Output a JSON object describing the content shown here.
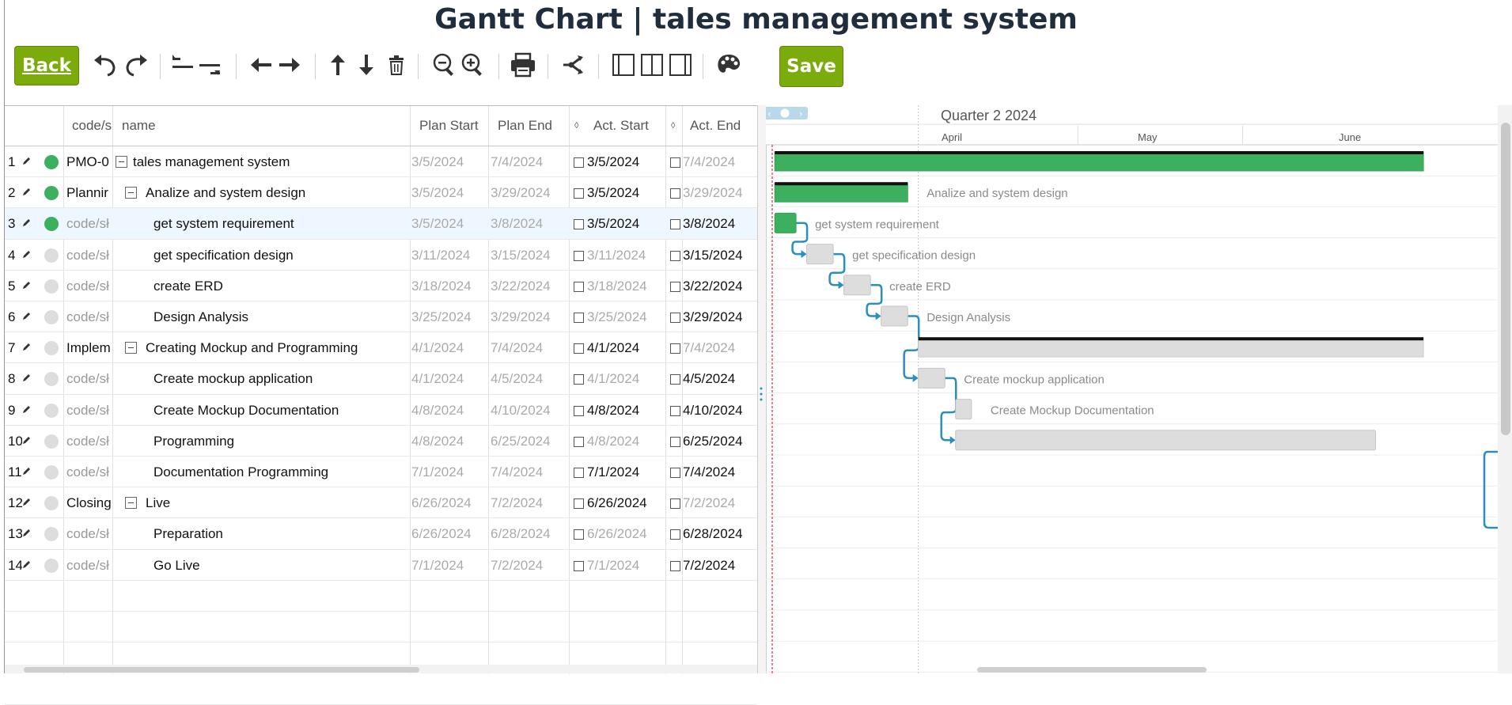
{
  "page_title": "Gantt Chart | tales management system",
  "toolbar": {
    "back_label": "Back",
    "save_label": "Save"
  },
  "grid": {
    "headers": {
      "code": "code/s",
      "name": "name",
      "plan_start": "Plan Start",
      "plan_end": "Plan End",
      "act_start": "Act. Start",
      "act_end": "Act. End"
    },
    "rows": [
      {
        "num": "1",
        "code": "PMO-0",
        "name": "tales management system",
        "indent": 0,
        "collapse": true,
        "status": "on",
        "plan_start": "3/5/2024",
        "plan_end": "7/4/2024",
        "act_start": "3/5/2024",
        "act_start_on": true,
        "act_end": "7/4/2024",
        "act_end_on": false
      },
      {
        "num": "2",
        "code": "Plannir",
        "name": "Analize and system design",
        "indent": 1,
        "collapse": true,
        "status": "on",
        "plan_start": "3/5/2024",
        "plan_end": "3/29/2024",
        "act_start": "3/5/2024",
        "act_start_on": true,
        "act_end": "3/29/2024",
        "act_end_on": false
      },
      {
        "num": "3",
        "code": "code/sł",
        "name": "get system requirement",
        "indent": 2,
        "collapse": false,
        "status": "on",
        "plan_start": "3/5/2024",
        "plan_end": "3/8/2024",
        "act_start": "3/5/2024",
        "act_start_on": true,
        "act_end": "3/8/2024",
        "act_end_on": true,
        "selected": true
      },
      {
        "num": "4",
        "code": "code/sł",
        "name": "get specification design",
        "indent": 2,
        "collapse": false,
        "status": "off",
        "plan_start": "3/11/2024",
        "plan_end": "3/15/2024",
        "act_start": "3/11/2024",
        "act_start_on": false,
        "act_end": "3/15/2024",
        "act_end_on": true
      },
      {
        "num": "5",
        "code": "code/sł",
        "name": "create ERD",
        "indent": 2,
        "collapse": false,
        "status": "off",
        "plan_start": "3/18/2024",
        "plan_end": "3/22/2024",
        "act_start": "3/18/2024",
        "act_start_on": false,
        "act_end": "3/22/2024",
        "act_end_on": true
      },
      {
        "num": "6",
        "code": "code/sł",
        "name": "Design Analysis",
        "indent": 2,
        "collapse": false,
        "status": "off",
        "plan_start": "3/25/2024",
        "plan_end": "3/29/2024",
        "act_start": "3/25/2024",
        "act_start_on": false,
        "act_end": "3/29/2024",
        "act_end_on": true
      },
      {
        "num": "7",
        "code": "Implem",
        "name": "Creating Mockup and Programming",
        "indent": 1,
        "collapse": true,
        "status": "off",
        "plan_start": "4/1/2024",
        "plan_end": "7/4/2024",
        "act_start": "4/1/2024",
        "act_start_on": true,
        "act_end": "7/4/2024",
        "act_end_on": false
      },
      {
        "num": "8",
        "code": "code/sł",
        "name": "Create mockup application",
        "indent": 2,
        "collapse": false,
        "status": "off",
        "plan_start": "4/1/2024",
        "plan_end": "4/5/2024",
        "act_start": "4/1/2024",
        "act_start_on": false,
        "act_end": "4/5/2024",
        "act_end_on": true
      },
      {
        "num": "9",
        "code": "code/sł",
        "name": "Create Mockup Documentation",
        "indent": 2,
        "collapse": false,
        "status": "off",
        "plan_start": "4/8/2024",
        "plan_end": "4/10/2024",
        "act_start": "4/8/2024",
        "act_start_on": true,
        "act_end": "4/10/2024",
        "act_end_on": true
      },
      {
        "num": "10",
        "code": "code/sł",
        "name": "Programming",
        "indent": 2,
        "collapse": false,
        "status": "off",
        "plan_start": "4/8/2024",
        "plan_end": "6/25/2024",
        "act_start": "4/8/2024",
        "act_start_on": false,
        "act_end": "6/25/2024",
        "act_end_on": true
      },
      {
        "num": "11",
        "code": "code/sł",
        "name": "Documentation Programming",
        "indent": 2,
        "collapse": false,
        "status": "off",
        "plan_start": "7/1/2024",
        "plan_end": "7/4/2024",
        "act_start": "7/1/2024",
        "act_start_on": true,
        "act_end": "7/4/2024",
        "act_end_on": true
      },
      {
        "num": "12",
        "code": "Closing",
        "name": "Live",
        "indent": 1,
        "collapse": true,
        "status": "off",
        "plan_start": "6/26/2024",
        "plan_end": "7/2/2024",
        "act_start": "6/26/2024",
        "act_start_on": true,
        "act_end": "7/2/2024",
        "act_end_on": false
      },
      {
        "num": "13",
        "code": "code/sł",
        "name": "Preparation",
        "indent": 2,
        "collapse": false,
        "status": "off",
        "plan_start": "6/26/2024",
        "plan_end": "6/28/2024",
        "act_start": "6/26/2024",
        "act_start_on": false,
        "act_end": "6/28/2024",
        "act_end_on": true
      },
      {
        "num": "14",
        "code": "code/sł",
        "name": "Go Live",
        "indent": 2,
        "collapse": false,
        "status": "off",
        "plan_start": "7/1/2024",
        "plan_end": "7/2/2024",
        "act_start": "7/1/2024",
        "act_start_on": false,
        "act_end": "7/2/2024",
        "act_end_on": true
      }
    ]
  },
  "timeline": {
    "quarter_label": "Quarter 2 2024",
    "months": [
      "April",
      "May",
      "June"
    ],
    "colors": {
      "done": "#3cb05e",
      "todo": "#dddddd",
      "link": "#2a8fbd",
      "today": "#e05a6b"
    },
    "bars": [
      {
        "row": 0,
        "start": "3/5/2024",
        "end": "7/4/2024",
        "type": "summary",
        "progress": 1,
        "label": ""
      },
      {
        "row": 1,
        "start": "3/5/2024",
        "end": "3/29/2024",
        "type": "summary",
        "progress": 1,
        "label": "Analize and system design"
      },
      {
        "row": 2,
        "start": "3/5/2024",
        "end": "3/8/2024",
        "type": "task",
        "progress": 1,
        "label": "get system requirement"
      },
      {
        "row": 3,
        "start": "3/11/2024",
        "end": "3/15/2024",
        "type": "task",
        "progress": 0,
        "label": "get specification design"
      },
      {
        "row": 4,
        "start": "3/18/2024",
        "end": "3/22/2024",
        "type": "task",
        "progress": 0,
        "label": "create ERD"
      },
      {
        "row": 5,
        "start": "3/25/2024",
        "end": "3/29/2024",
        "type": "task",
        "progress": 0,
        "label": "Design Analysis"
      },
      {
        "row": 6,
        "start": "4/1/2024",
        "end": "7/4/2024",
        "type": "summary",
        "progress": 0,
        "label": ""
      },
      {
        "row": 7,
        "start": "4/1/2024",
        "end": "4/5/2024",
        "type": "task",
        "progress": 0,
        "label": "Create mockup application"
      },
      {
        "row": 8,
        "start": "4/8/2024",
        "end": "4/10/2024",
        "type": "task",
        "progress": 0,
        "label": "Create Mockup Documentation"
      },
      {
        "row": 9,
        "start": "4/8/2024",
        "end": "6/25/2024",
        "type": "task",
        "progress": 0,
        "label": ""
      }
    ],
    "links": [
      [
        2,
        3
      ],
      [
        3,
        4
      ],
      [
        4,
        5
      ],
      [
        5,
        7
      ],
      [
        7,
        9
      ]
    ]
  }
}
